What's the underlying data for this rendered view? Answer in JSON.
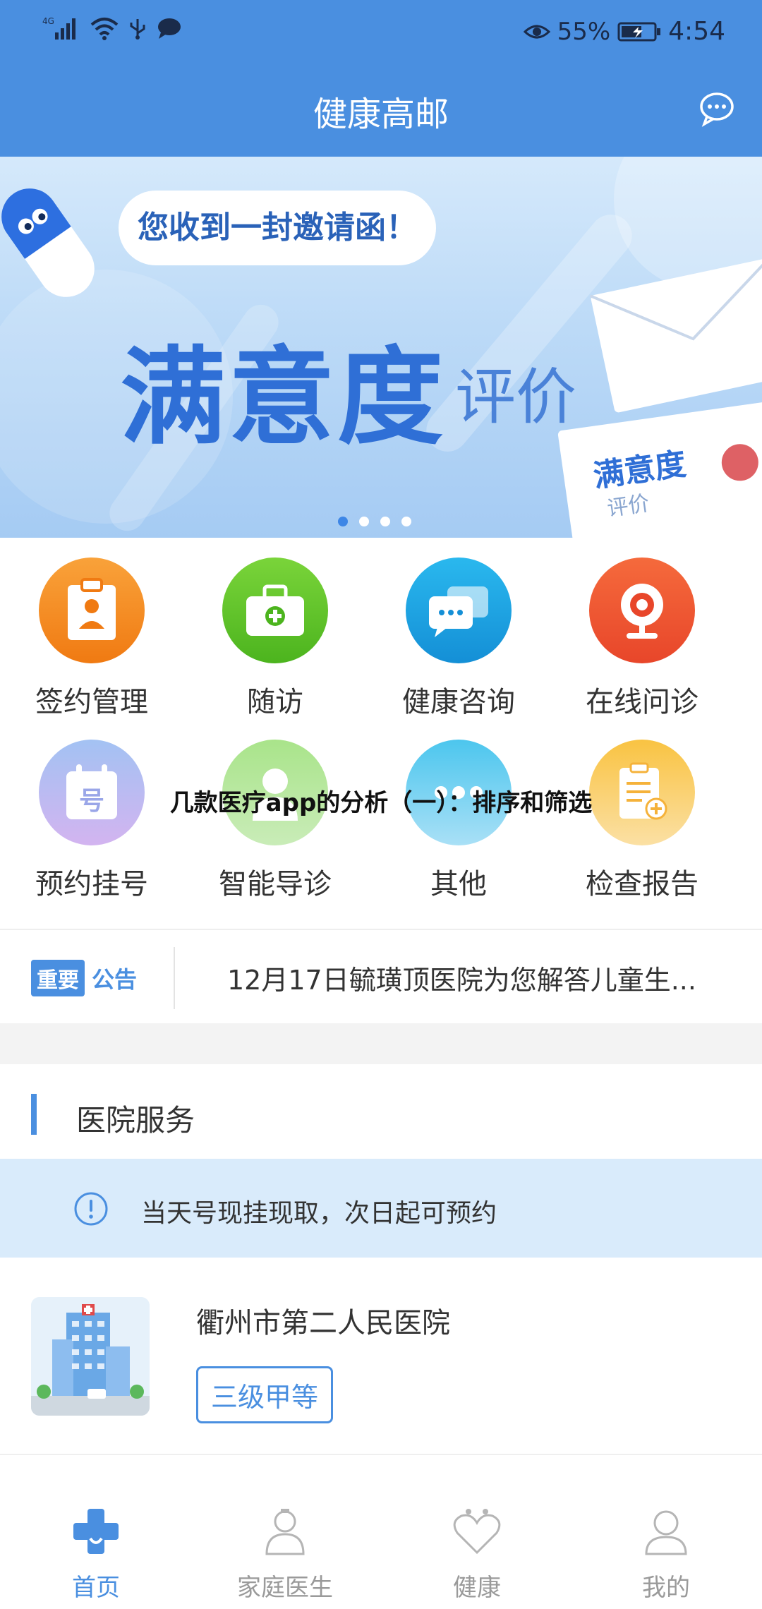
{
  "status_bar": {
    "network": "4G",
    "battery": "55%",
    "time": "4:54"
  },
  "header": {
    "title": "健康高邮"
  },
  "banner": {
    "invite_text": "您收到一封邀请函！",
    "main_title": "满意度",
    "sub_title": "评价",
    "envelope_text": "满意度",
    "envelope_sub": "评价",
    "page_count": 4,
    "active_page": 1
  },
  "grid": {
    "items": [
      {
        "label": "签约管理",
        "icon": "clipboard-icon",
        "color": "#f48a1e"
      },
      {
        "label": "随访",
        "icon": "medical-kit-icon",
        "color": "#59c22a"
      },
      {
        "label": "健康咨询",
        "icon": "chat-bubbles-icon",
        "color": "#1a9ee0"
      },
      {
        "label": "在线问诊",
        "icon": "webcam-icon",
        "color": "#ef5530"
      },
      {
        "label": "预约挂号",
        "icon": "calendar-icon",
        "color": "#8f96e8"
      },
      {
        "label": "智能导诊",
        "icon": "doctor-icon",
        "color": "#7dd45a"
      },
      {
        "label": "其他",
        "icon": "more-icon",
        "color": "#35b6e8"
      },
      {
        "label": "检查报告",
        "icon": "report-icon",
        "color": "#f5b23a"
      }
    ]
  },
  "overlay_caption": "几款医疗app的分析（一）：排序和筛选",
  "notice": {
    "tag1": "重要",
    "tag2": "公告",
    "text": "12月17日毓璜顶医院为您解答儿童生..."
  },
  "section": {
    "title": "医院服务"
  },
  "tip": {
    "text": "当天号现挂现取，次日起可预约"
  },
  "hospital": {
    "name": "衢州市第二人民医院",
    "level": "三级甲等"
  },
  "tabbar": {
    "tabs": [
      {
        "label": "首页",
        "icon": "home-medical-icon",
        "active": true
      },
      {
        "label": "家庭医生",
        "icon": "family-doctor-icon",
        "active": false
      },
      {
        "label": "健康",
        "icon": "health-heart-icon",
        "active": false
      },
      {
        "label": "我的",
        "icon": "user-icon",
        "active": false
      }
    ]
  },
  "colors": {
    "primary": "#4a8fe0",
    "tip_background": "#d9ebfb"
  }
}
